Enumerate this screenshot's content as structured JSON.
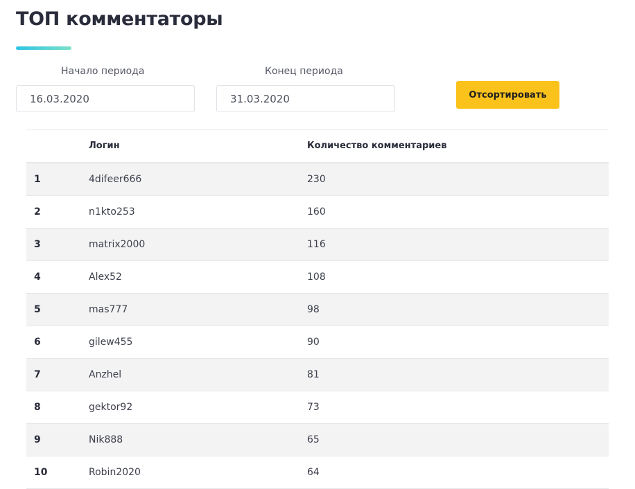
{
  "page": {
    "title": "ТОП комментаторы"
  },
  "filters": {
    "start_label": "Начало периода",
    "start_value": "16.03.2020",
    "end_label": "Конец периода",
    "end_value": "31.03.2020",
    "sort_button_label": "Отсортировать"
  },
  "colors": {
    "accent_button": "#fbc21c",
    "underline_gradient_start": "#2ec4e6",
    "underline_gradient_end": "#7be0c6",
    "row_alt_background": "#f3f3f4"
  },
  "table": {
    "columns": {
      "rank": "",
      "login": "Логин",
      "count": "Количество комментариев"
    },
    "rows": [
      {
        "rank": "1",
        "login": "4difeer666",
        "count": "230"
      },
      {
        "rank": "2",
        "login": "n1kto253",
        "count": "160"
      },
      {
        "rank": "3",
        "login": "matrix2000",
        "count": "116"
      },
      {
        "rank": "4",
        "login": "Alex52",
        "count": "108"
      },
      {
        "rank": "5",
        "login": "mas777",
        "count": "98"
      },
      {
        "rank": "6",
        "login": "gilew455",
        "count": "90"
      },
      {
        "rank": "7",
        "login": "Anzhel",
        "count": "81"
      },
      {
        "rank": "8",
        "login": "gektor92",
        "count": "73"
      },
      {
        "rank": "9",
        "login": "Nik888",
        "count": "65"
      },
      {
        "rank": "10",
        "login": "Robin2020",
        "count": "64"
      }
    ]
  }
}
